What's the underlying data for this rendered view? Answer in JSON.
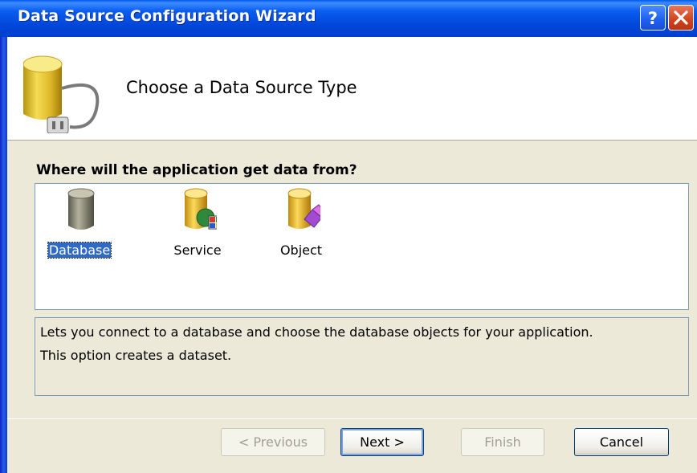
{
  "window": {
    "title": "Data Source Configuration Wizard"
  },
  "titlebar": {
    "help_icon": "question-mark-icon",
    "close_icon": "close-x-icon"
  },
  "header": {
    "icon": "database-plug-icon",
    "title": "Choose a Data Source Type"
  },
  "question": "Where will the application get data from?",
  "sources": [
    {
      "label": "Database",
      "icon": "database-icon",
      "selected": true
    },
    {
      "label": "Service",
      "icon": "service-icon",
      "selected": false
    },
    {
      "label": "Object",
      "icon": "object-icon",
      "selected": false
    }
  ],
  "description": {
    "line1": "Lets you connect to a database and choose the database objects for your application.",
    "line2": "This option creates a  dataset."
  },
  "buttons": {
    "previous": "< Previous",
    "next": "Next >",
    "finish": "Finish",
    "cancel": "Cancel"
  },
  "colors": {
    "title_bar": "#0058ee",
    "selection": "#316ac5",
    "dialog_bg": "#ece9d8"
  }
}
